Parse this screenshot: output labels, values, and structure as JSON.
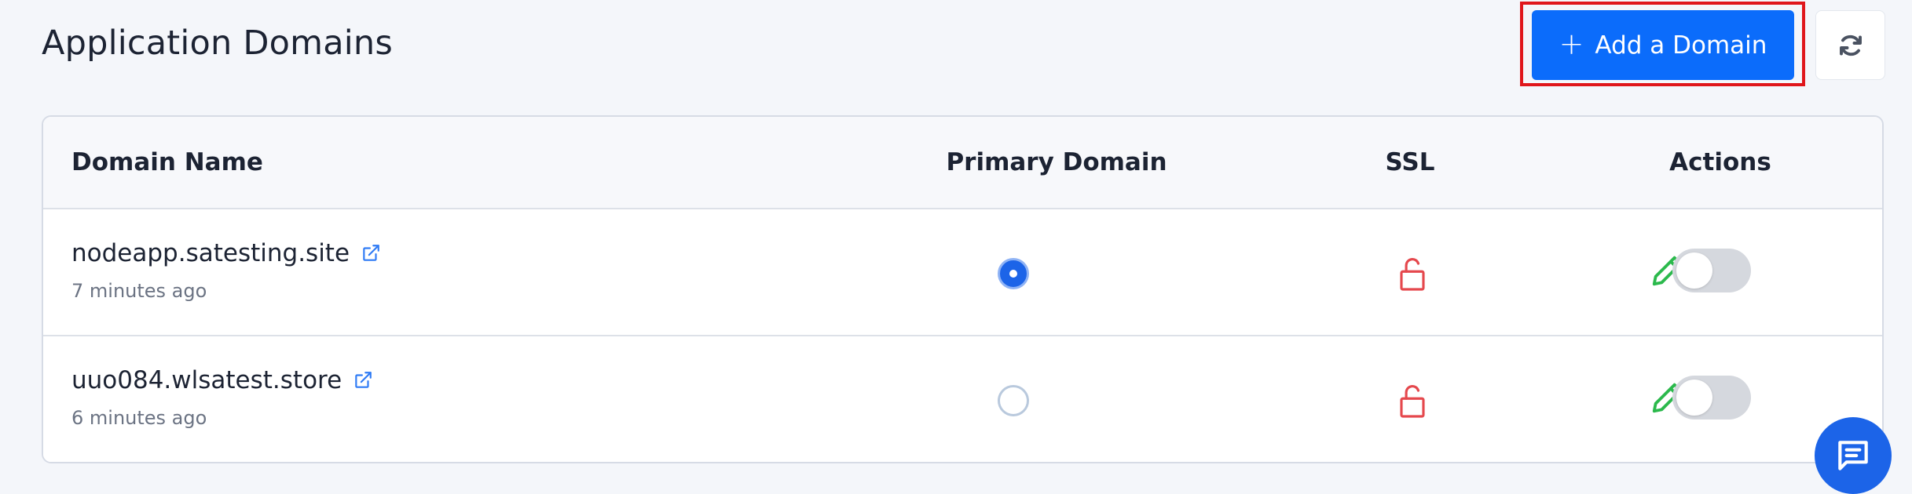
{
  "page": {
    "title": "Application Domains"
  },
  "toolbar": {
    "add_domain_label": "Add a Domain",
    "add_domain_icon": "plus-icon",
    "refresh_icon": "refresh-icon"
  },
  "table": {
    "columns": [
      "Domain Name",
      "Primary Domain",
      "SSL",
      "Actions"
    ],
    "rows": [
      {
        "domain": "nodeapp.satesting.site",
        "time": "7 minutes ago",
        "primary": true,
        "ssl_icon": "unlocked-icon",
        "ssl_status_color": "#e5484d",
        "enabled": false
      },
      {
        "domain": "uuo084.wlsatest.store",
        "time": "6 minutes ago",
        "primary": false,
        "ssl_icon": "unlocked-icon",
        "ssl_status_color": "#e5484d",
        "enabled": false
      }
    ]
  },
  "colors": {
    "accent": "#0b6cfb",
    "highlight": "#e0161b",
    "edit": "#2bb94c",
    "external_link": "#2f7bf5"
  }
}
